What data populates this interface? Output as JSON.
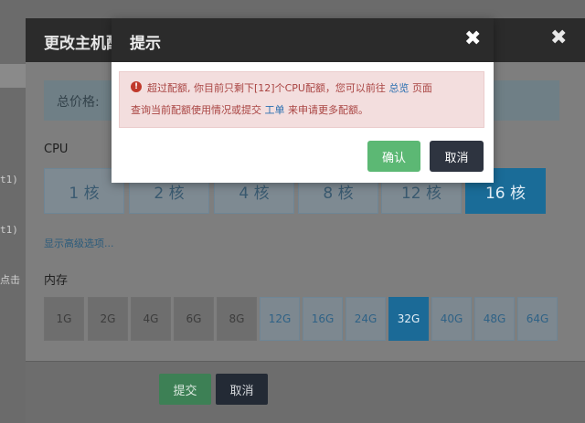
{
  "background": {
    "snippets": [
      "t1)",
      "t1)",
      "点击"
    ]
  },
  "modal": {
    "title": "更改主机配置",
    "close_glyph": "✖",
    "price_label": "总价格:",
    "cpu_label": "CPU",
    "cpu_options": [
      "1 核",
      "2 核",
      "4 核",
      "8 核",
      "12 核",
      "16 核"
    ],
    "cpu_selected": "16 核",
    "advanced_link": "显示高级选项...",
    "memory_label": "内存",
    "memory_options": [
      "1G",
      "2G",
      "4G",
      "6G",
      "8G",
      "12G",
      "16G",
      "24G",
      "32G",
      "40G",
      "48G",
      "64G"
    ],
    "memory_selected": "32G",
    "submit_label": "提交",
    "cancel_label": "取消"
  },
  "dialog": {
    "title": "提示",
    "close_glyph": "✖",
    "alert_icon": "!",
    "message_part1": "超过配额, 你目前只剩下[12]个CPU配额，您可以前往",
    "link_overview": "总览",
    "message_part2": "页面",
    "message_part3": "查询当前配额使用情况或提交",
    "link_ticket": "工单",
    "message_part4": "来申请更多配额。",
    "confirm_label": "确认",
    "cancel_label": "取消"
  },
  "colors": {
    "accent_blue": "#1b6a97",
    "confirm_green": "#5cb874",
    "alert_text": "#a94442",
    "alert_bg": "#f3dede"
  },
  "icons": {
    "close": "close-icon",
    "alert": "exclamation-circle-icon"
  }
}
